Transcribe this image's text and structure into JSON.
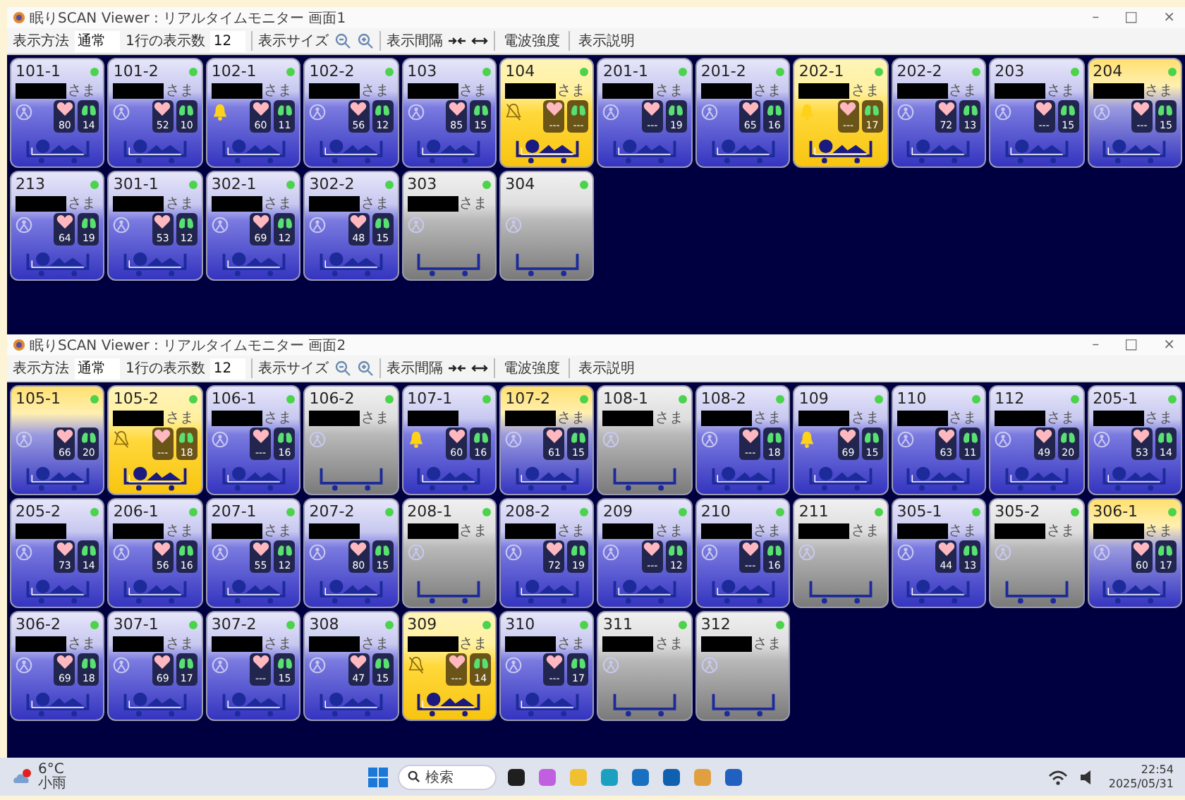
{
  "windows": [
    {
      "title": "眠りSCAN Viewer : リアルタイムモニター 画面1",
      "controls": [
        "–",
        "□",
        "×"
      ],
      "toolbar": {
        "mode_label": "表示方法",
        "mode": "通常",
        "count_label": "1行の表示数",
        "count": "12",
        "size_label": "表示サイズ",
        "interval_label": "表示間隔",
        "signal_label": "電波強度",
        "legend_label": "表示説明"
      },
      "tiles": [
        {
          "room": "101-1",
          "kind": "occupied",
          "alarm": false,
          "muted": false,
          "redacted": true,
          "honorific": "さま",
          "heart": "80",
          "resp": "14"
        },
        {
          "room": "101-2",
          "kind": "occupied",
          "alarm": false,
          "muted": false,
          "redacted": true,
          "honorific": "さま",
          "heart": "52",
          "resp": "10"
        },
        {
          "room": "102-1",
          "kind": "occupied",
          "alarm": true,
          "muted": false,
          "redacted": true,
          "honorific": "さま",
          "heart": "60",
          "resp": "11"
        },
        {
          "room": "102-2",
          "kind": "occupied",
          "alarm": false,
          "muted": false,
          "redacted": true,
          "honorific": "さま",
          "heart": "56",
          "resp": "12"
        },
        {
          "room": "103",
          "kind": "occupied",
          "alarm": false,
          "muted": false,
          "redacted": true,
          "honorific": "さま",
          "heart": "85",
          "resp": "15"
        },
        {
          "room": "104",
          "kind": "alert",
          "alarm": false,
          "muted": true,
          "redacted": true,
          "honorific": "さま",
          "heart": "---",
          "resp": "---"
        },
        {
          "room": "201-1",
          "kind": "occupied",
          "alarm": false,
          "muted": false,
          "redacted": true,
          "honorific": "さま",
          "heart": "---",
          "resp": "19"
        },
        {
          "room": "201-2",
          "kind": "occupied",
          "alarm": false,
          "muted": false,
          "redacted": true,
          "honorific": "さま",
          "heart": "65",
          "resp": "16"
        },
        {
          "room": "202-1",
          "kind": "alert",
          "alarm": true,
          "muted": false,
          "redacted": true,
          "honorific": "さま",
          "heart": "---",
          "resp": "17"
        },
        {
          "room": "202-2",
          "kind": "occupied",
          "alarm": false,
          "muted": false,
          "redacted": true,
          "honorific": "さま",
          "heart": "72",
          "resp": "13"
        },
        {
          "room": "203",
          "kind": "occupied",
          "alarm": false,
          "muted": false,
          "redacted": true,
          "honorific": "さま",
          "heart": "---",
          "resp": "15"
        },
        {
          "room": "204",
          "kind": "attention",
          "alarm": false,
          "muted": false,
          "redacted": true,
          "honorific": "さま",
          "heart": "---",
          "resp": "15"
        },
        {
          "room": "213",
          "kind": "occupied",
          "alarm": false,
          "muted": false,
          "redacted": true,
          "honorific": "さま",
          "heart": "64",
          "resp": "19"
        },
        {
          "room": "301-1",
          "kind": "occupied",
          "alarm": false,
          "muted": false,
          "redacted": true,
          "honorific": "さま",
          "heart": "53",
          "resp": "12"
        },
        {
          "room": "302-1",
          "kind": "occupied",
          "alarm": false,
          "muted": false,
          "redacted": true,
          "honorific": "さま",
          "heart": "69",
          "resp": "12"
        },
        {
          "room": "302-2",
          "kind": "occupied",
          "alarm": false,
          "muted": false,
          "redacted": true,
          "honorific": "さま",
          "heart": "48",
          "resp": "15"
        },
        {
          "room": "303",
          "kind": "empty",
          "alarm": false,
          "muted": false,
          "redacted": true,
          "honorific": "さま"
        },
        {
          "room": "304",
          "kind": "empty",
          "alarm": false,
          "muted": false,
          "redacted": false
        }
      ]
    },
    {
      "title": "眠りSCAN Viewer : リアルタイムモニター 画面2",
      "controls": [
        "–",
        "□",
        "×"
      ],
      "toolbar": {
        "mode_label": "表示方法",
        "mode": "通常",
        "count_label": "1行の表示数",
        "count": "12",
        "size_label": "表示サイズ",
        "interval_label": "表示間隔",
        "signal_label": "電波強度",
        "legend_label": "表示説明"
      },
      "tiles": [
        {
          "room": "105-1",
          "kind": "attention",
          "alarm": false,
          "muted": false,
          "redacted": false,
          "heart": "66",
          "resp": "20"
        },
        {
          "room": "105-2",
          "kind": "alert",
          "alarm": false,
          "muted": true,
          "redacted": true,
          "honorific": "さま",
          "heart": "---",
          "resp": "18"
        },
        {
          "room": "106-1",
          "kind": "occupied",
          "alarm": false,
          "muted": false,
          "redacted": true,
          "honorific": "さま",
          "heart": "---",
          "resp": "16"
        },
        {
          "room": "106-2",
          "kind": "empty",
          "alarm": false,
          "muted": false,
          "redacted": true,
          "honorific": "さま"
        },
        {
          "room": "107-1",
          "kind": "occupied",
          "alarm": true,
          "muted": false,
          "redacted": true,
          "heart": "60",
          "resp": "16"
        },
        {
          "room": "107-2",
          "kind": "attention",
          "alarm": false,
          "muted": false,
          "redacted": true,
          "honorific": "さま",
          "heart": "61",
          "resp": "15"
        },
        {
          "room": "108-1",
          "kind": "empty",
          "alarm": false,
          "muted": false,
          "redacted": true,
          "honorific": "さま"
        },
        {
          "room": "108-2",
          "kind": "occupied",
          "alarm": false,
          "muted": false,
          "redacted": true,
          "honorific": "さま",
          "heart": "---",
          "resp": "18"
        },
        {
          "room": "109",
          "kind": "occupied",
          "alarm": true,
          "muted": false,
          "redacted": true,
          "honorific": "さま",
          "heart": "69",
          "resp": "15"
        },
        {
          "room": "110",
          "kind": "occupied",
          "alarm": false,
          "muted": false,
          "redacted": true,
          "honorific": "さま",
          "heart": "63",
          "resp": "11"
        },
        {
          "room": "112",
          "kind": "occupied",
          "alarm": false,
          "muted": false,
          "redacted": true,
          "honorific": "さま",
          "heart": "49",
          "resp": "20"
        },
        {
          "room": "205-1",
          "kind": "occupied",
          "alarm": false,
          "muted": false,
          "redacted": true,
          "honorific": "さま",
          "heart": "53",
          "resp": "14"
        },
        {
          "room": "205-2",
          "kind": "occupied",
          "alarm": false,
          "muted": false,
          "redacted": true,
          "heart": "73",
          "resp": "14"
        },
        {
          "room": "206-1",
          "kind": "occupied",
          "alarm": false,
          "muted": false,
          "redacted": true,
          "honorific": "さま",
          "heart": "56",
          "resp": "16"
        },
        {
          "room": "207-1",
          "kind": "occupied",
          "alarm": false,
          "muted": false,
          "redacted": true,
          "honorific": "さま",
          "heart": "55",
          "resp": "12"
        },
        {
          "room": "207-2",
          "kind": "occupied",
          "alarm": false,
          "muted": false,
          "redacted": true,
          "heart": "80",
          "resp": "15"
        },
        {
          "room": "208-1",
          "kind": "empty",
          "alarm": false,
          "muted": false,
          "redacted": true,
          "honorific": "さま"
        },
        {
          "room": "208-2",
          "kind": "occupied",
          "alarm": false,
          "muted": false,
          "redacted": true,
          "honorific": "さま",
          "heart": "72",
          "resp": "19"
        },
        {
          "room": "209",
          "kind": "occupied",
          "alarm": false,
          "muted": false,
          "redacted": true,
          "honorific": "さま",
          "heart": "---",
          "resp": "12"
        },
        {
          "room": "210",
          "kind": "occupied",
          "alarm": false,
          "muted": false,
          "redacted": true,
          "honorific": "さま",
          "heart": "---",
          "resp": "16"
        },
        {
          "room": "211",
          "kind": "empty",
          "alarm": false,
          "muted": false,
          "redacted": true,
          "honorific": "さま"
        },
        {
          "room": "305-1",
          "kind": "occupied",
          "alarm": false,
          "muted": false,
          "redacted": true,
          "honorific": "さま",
          "heart": "44",
          "resp": "13"
        },
        {
          "room": "305-2",
          "kind": "empty",
          "alarm": false,
          "muted": false,
          "redacted": true,
          "honorific": "さま"
        },
        {
          "room": "306-1",
          "kind": "attention",
          "alarm": false,
          "muted": false,
          "redacted": true,
          "honorific": "さま",
          "heart": "60",
          "resp": "17"
        },
        {
          "room": "306-2",
          "kind": "occupied",
          "alarm": false,
          "muted": false,
          "redacted": true,
          "honorific": "さま",
          "heart": "69",
          "resp": "18"
        },
        {
          "room": "307-1",
          "kind": "occupied",
          "alarm": false,
          "muted": false,
          "redacted": true,
          "honorific": "さま",
          "heart": "69",
          "resp": "17"
        },
        {
          "room": "307-2",
          "kind": "occupied",
          "alarm": false,
          "muted": false,
          "redacted": true,
          "honorific": "さま",
          "heart": "---",
          "resp": "15"
        },
        {
          "room": "308",
          "kind": "occupied",
          "alarm": false,
          "muted": false,
          "redacted": true,
          "honorific": "さま",
          "heart": "47",
          "resp": "15"
        },
        {
          "room": "309",
          "kind": "alert",
          "alarm": false,
          "muted": true,
          "redacted": true,
          "honorific": "さま",
          "heart": "---",
          "resp": "14"
        },
        {
          "room": "310",
          "kind": "occupied",
          "alarm": false,
          "muted": false,
          "redacted": true,
          "honorific": "さま",
          "heart": "---",
          "resp": "17"
        },
        {
          "room": "311",
          "kind": "empty",
          "alarm": false,
          "muted": false,
          "redacted": true,
          "honorific": "さま"
        },
        {
          "room": "312",
          "kind": "empty",
          "alarm": false,
          "muted": false,
          "redacted": true,
          "honorific": "さま"
        }
      ]
    }
  ],
  "taskbar": {
    "temperature": "6°C",
    "weather": "小雨",
    "search_placeholder": "検索",
    "time": "22:54",
    "date": "2025/05/31"
  }
}
